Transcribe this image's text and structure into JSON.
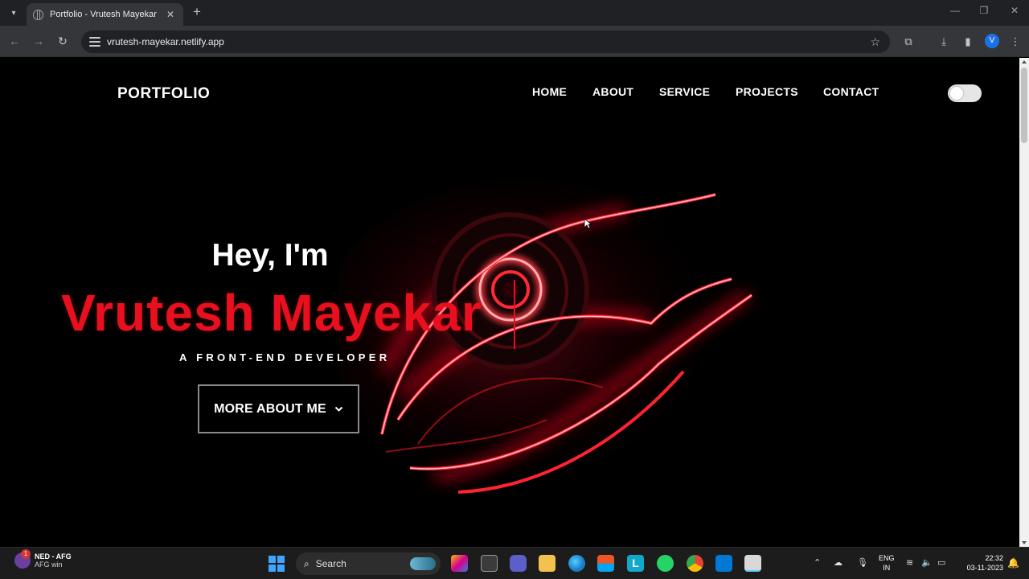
{
  "browser": {
    "tab_title": "Portfolio - Vrutesh Mayekar",
    "tab_close": "✕",
    "new_tab": "+",
    "url": "vrutesh-mayekar.netlify.app",
    "profile_initial": "V"
  },
  "site": {
    "logo": "PORTFOLIO",
    "nav": [
      "HOME",
      "ABOUT",
      "SERVICE",
      "PROJECTS",
      "CONTACT"
    ],
    "theme_toggle_on": false,
    "greeting": "Hey, I'm",
    "name": "Vrutesh Mayekar",
    "role": "A FRONT-END DEVELOPER",
    "cta_label": "MORE ABOUT ME",
    "accent_color": "#e8101f"
  },
  "taskbar": {
    "weather_title": "NED - AFG",
    "weather_sub": "AFG win",
    "weather_badge": "1",
    "search_label": "Search",
    "lang_line1": "ENG",
    "lang_line2": "IN",
    "time": "22:32",
    "date": "03-11-2023"
  }
}
